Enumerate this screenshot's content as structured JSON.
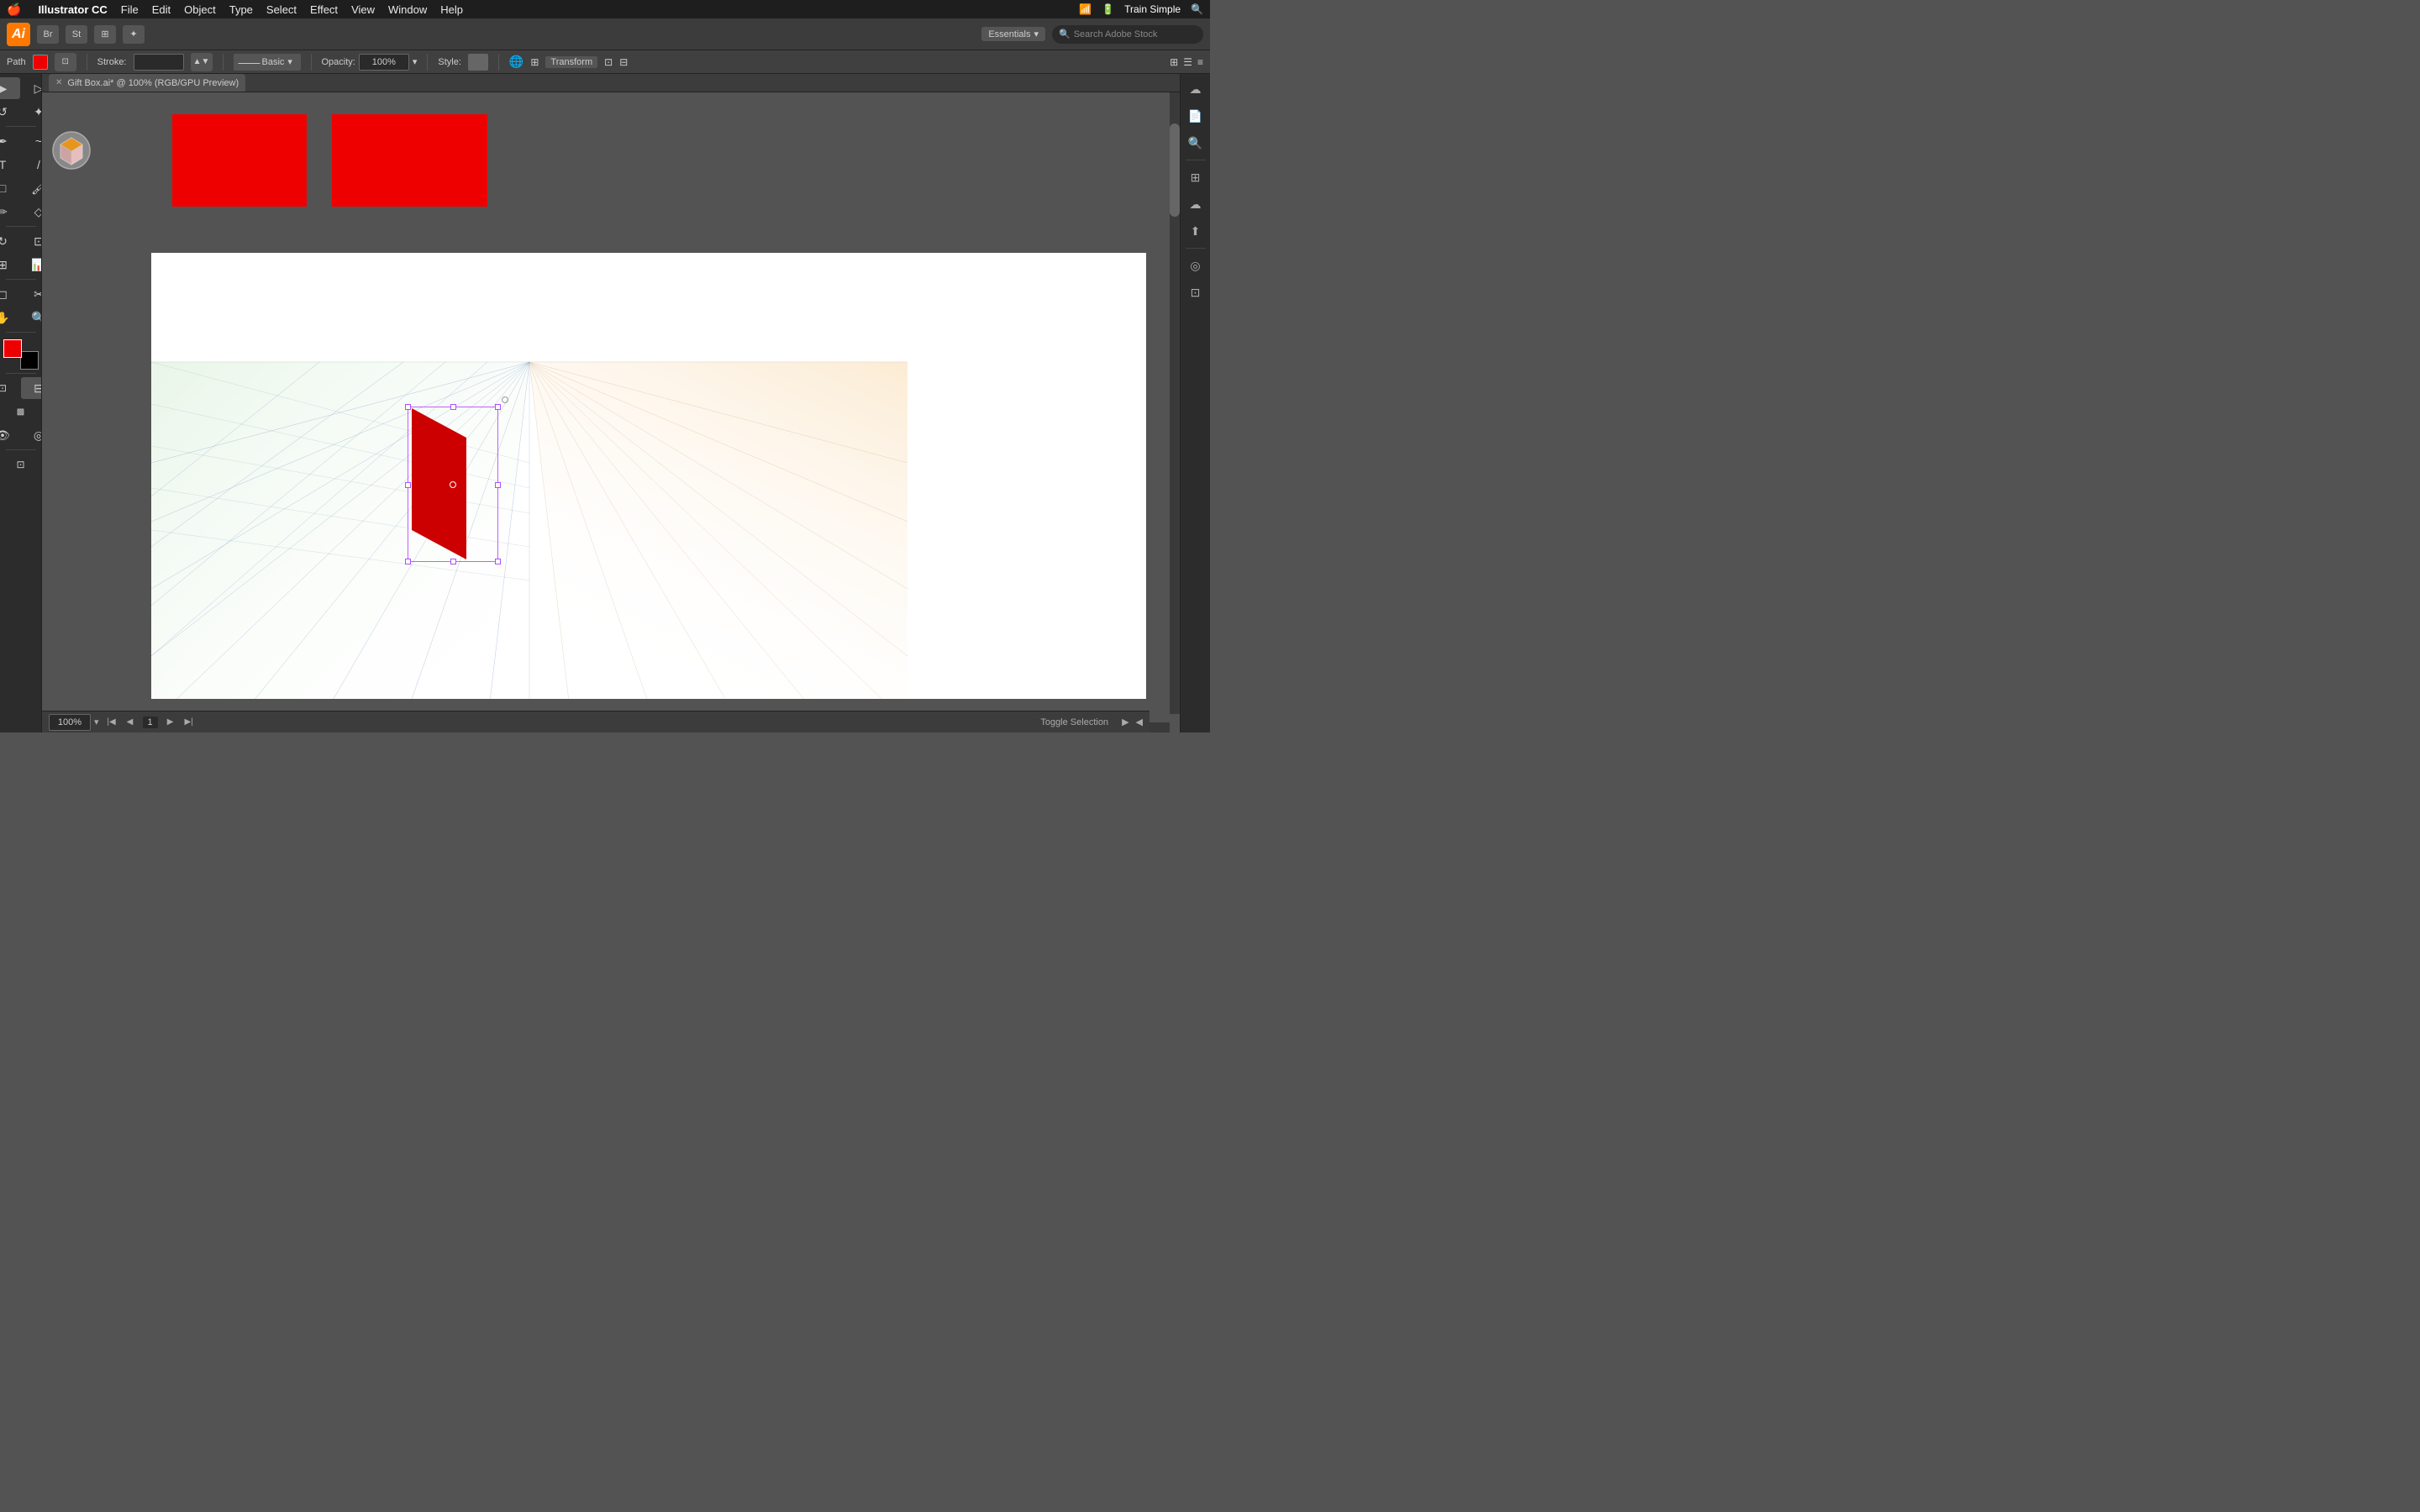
{
  "menubar": {
    "apple": "🍎",
    "app_name": "Illustrator CC",
    "menus": [
      "File",
      "Edit",
      "Object",
      "Type",
      "Select",
      "Effect",
      "View",
      "Window",
      "Help"
    ],
    "right_items": [
      "Train Simple",
      "🔍",
      "☰"
    ]
  },
  "toolbar": {
    "logo_text": "Ai",
    "essentials_label": "Essentials",
    "search_placeholder": "Search Adobe Stock"
  },
  "props_bar": {
    "label": "Path",
    "stroke_label": "Stroke:",
    "stroke_value": "",
    "basic_label": "Basic",
    "opacity_label": "Opacity:",
    "opacity_value": "100%",
    "style_label": "Style:",
    "transform_label": "Transform"
  },
  "document": {
    "tab_title": "Gift Box.ai* @ 100% (RGB/GPU Preview)"
  },
  "status_bar": {
    "zoom": "100%",
    "page": "1",
    "message": "Toggle Selection"
  }
}
